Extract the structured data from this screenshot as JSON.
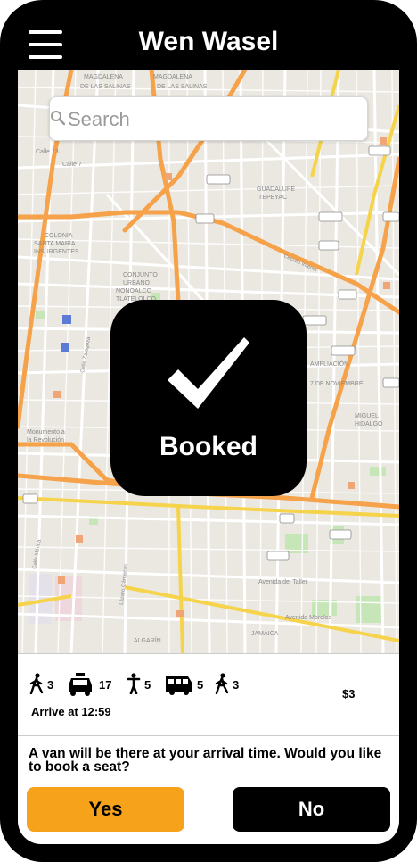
{
  "header": {
    "title": "Wen Wasel",
    "menu_icon": "hamburger-menu-icon"
  },
  "search": {
    "placeholder": "Search",
    "icon": "search-icon"
  },
  "map": {
    "labels": {
      "magdalena_mixhuca": "MAGDALENA",
      "de_las_salinas": "DE LAS SALINAS",
      "calle_13": "Calle 13",
      "calle_7": "Calle 7",
      "colonia_santa_maria": "COLONIA",
      "santa_maria": "SANTA MARÍA",
      "insurgentes": "INSURGENTES",
      "guadalupe": "GUADALUPE",
      "tepeyac": "TEPEYAC",
      "conjunto_urbano": "CONJUNTO",
      "urbano": "URBANO",
      "nonoalco": "NONOALCO",
      "tlatelolco": "TLATELOLCO",
      "calle_zaragoza": "Calle Zaragoza",
      "monumento": "Monumento a",
      "revolucion": "la Revolución",
      "miguel_hidalgo": "MIGUEL",
      "hidalgo": "HIDALGO",
      "ampliacion": "AMPLIACIÓN",
      "caminos": "7 DE NOVIEMBRE",
      "avenida_taller": "Avenida del Taller",
      "avenida_morelos": "Avenida Morelos",
      "algarin": "ALGARÍN",
      "jamaica": "JAMAICA",
      "calle_merida": "Calle Mérida",
      "lazaro": "Lázaro Cárdenas",
      "circuito": "Circuito Interior"
    }
  },
  "booked": {
    "label": "Booked",
    "icon": "checkmark-icon"
  },
  "trip": {
    "segments": [
      {
        "icon": "walk-icon",
        "value": "3"
      },
      {
        "icon": "taxi-icon",
        "value": "17"
      },
      {
        "icon": "stand-icon",
        "value": "5"
      },
      {
        "icon": "van-icon",
        "value": "5"
      },
      {
        "icon": "walk-icon",
        "value": "3"
      }
    ],
    "arrive": "Arrive at 12:59",
    "price": "$3"
  },
  "prompt": {
    "question": "A van will be there at your arrival time. Would you like to book a seat?",
    "yes_label": "Yes",
    "no_label": "No"
  },
  "colors": {
    "accent": "#f7a21b",
    "frame": "#000000",
    "road_major": "#f5a24a",
    "road_minor": "#ffffff",
    "map_bg": "#ebe8e1",
    "park": "#c6e6b8"
  }
}
